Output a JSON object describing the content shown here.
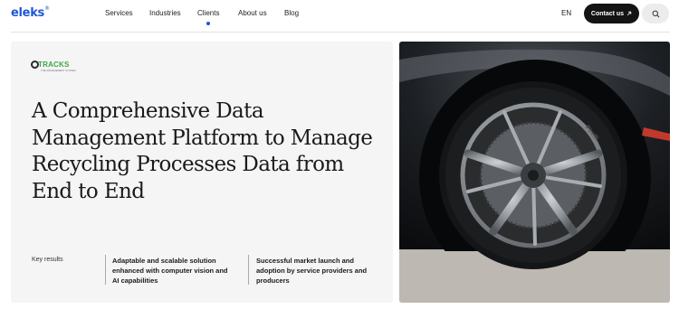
{
  "header": {
    "logo_text": "eleks",
    "logo_mark": "®",
    "nav": [
      "Services",
      "Industries",
      "Clients",
      "About us",
      "Blog"
    ],
    "active_nav": "Clients",
    "language": "EN",
    "contact_label": "Contact us",
    "contact_icon": "arrow-up-right-icon",
    "search_icon": "search-icon"
  },
  "hero": {
    "client_logo": {
      "word": "TRACKS",
      "tagline": "THE MANAGEMENT SYSTEM"
    },
    "headline": "A Comprehensive Data Management Platform to Manage Recycling Processes Data from End to End",
    "key_results_label": "Key results",
    "results": [
      "Adaptable and scalable solution enhanced with computer vision and AI capabilities",
      "Successful market launch and adoption by service providers and producers"
    ]
  },
  "image": {
    "subject": "car-wheel-photo",
    "tire_brand": "Pirelli"
  },
  "colors": {
    "brand_blue": "#1e56d6",
    "button_dark": "#141414",
    "card_bg": "#f5f5f5",
    "client_green": "#3aa845"
  }
}
